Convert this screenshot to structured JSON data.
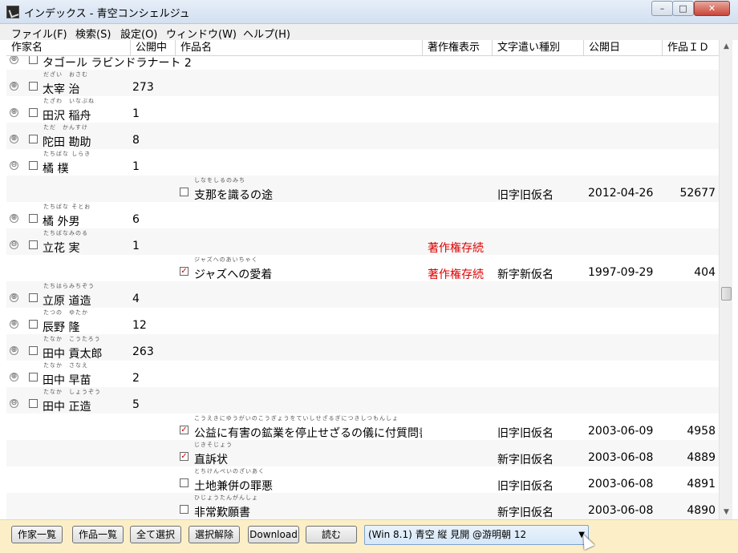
{
  "window": {
    "title": "インデックス - 青空コンシェルジュ",
    "min": "–",
    "max": "□",
    "close": "✕"
  },
  "menu": [
    "ファイル(F)",
    "検索(S)",
    "設定(O)",
    "ウィンドウ(W)",
    "ヘルプ(H)"
  ],
  "columns": [
    "作家名",
    "公開中",
    "作品名",
    "著作権表示",
    "文字遣い種別",
    "公開日",
    "作品ＩＤ"
  ],
  "rows": [
    {
      "type": "author",
      "expander": "⊕",
      "ruby": "",
      "name": "タゴール ラビンドラナート 2",
      "count": ""
    },
    {
      "type": "author",
      "expander": "⊕",
      "ruby": "だざい　おさむ",
      "name": "太宰 治",
      "count": "273"
    },
    {
      "type": "author",
      "expander": "⊕",
      "ruby": "たざわ　いなぶね",
      "name": "田沢 稲舟",
      "count": "1"
    },
    {
      "type": "author",
      "expander": "⊕",
      "ruby": "ただ　かんすけ",
      "name": "陀田 勘助",
      "count": "8"
    },
    {
      "type": "author",
      "expander": "⊖",
      "ruby": "たちばな しらき",
      "name": "橘 樸",
      "count": "1"
    },
    {
      "type": "work",
      "checked": false,
      "ruby": "しなをしるのみち",
      "title": "支那を識るの途",
      "copyright": "",
      "kana": "旧字旧仮名",
      "date": "2012-04-26",
      "id": "52677"
    },
    {
      "type": "author",
      "expander": "⊕",
      "ruby": "たちばな そとお",
      "name": "橘 外男",
      "count": "6"
    },
    {
      "type": "author",
      "expander": "⊖",
      "ruby": "たちばなみのる",
      "name": "立花 実",
      "count": "1",
      "copyright": "著作権存続"
    },
    {
      "type": "work",
      "checked": true,
      "ruby": "ジャズへのあいちゃく",
      "title": "ジャズへの愛着",
      "copyright": "著作権存続",
      "kana": "新字新仮名",
      "date": "1997-09-29",
      "id": "404"
    },
    {
      "type": "author",
      "expander": "⊕",
      "ruby": "たちはらみちぞう",
      "name": "立原 道造",
      "count": "4"
    },
    {
      "type": "author",
      "expander": "⊕",
      "ruby": "たつの　ゆたか",
      "name": "辰野 隆",
      "count": "12"
    },
    {
      "type": "author",
      "expander": "⊕",
      "ruby": "たなか　こうたろう",
      "name": "田中 貢太郎",
      "count": "263"
    },
    {
      "type": "author",
      "expander": "⊕",
      "ruby": "たなか　さなえ",
      "name": "田中 早苗",
      "count": "2"
    },
    {
      "type": "author",
      "expander": "⊖",
      "ruby": "たなか　しょうぞう",
      "name": "田中 正造",
      "count": "5"
    },
    {
      "type": "work",
      "checked": true,
      "ruby": "こうえきにゆうがいのこうぎょうをていしせざるぎにつきしつもんしょ",
      "title": "公益に有害の鉱業を停止せざるの儀に付質問書",
      "copyright": "",
      "kana": "旧字旧仮名",
      "date": "2003-06-09",
      "id": "4958"
    },
    {
      "type": "work",
      "checked": true,
      "ruby": "じきそじょう",
      "title": "直訴状",
      "copyright": "",
      "kana": "新字旧仮名",
      "date": "2003-06-08",
      "id": "4889"
    },
    {
      "type": "work",
      "checked": false,
      "ruby": "とちけんぺいのざいあく",
      "title": "土地兼併の罪悪",
      "copyright": "",
      "kana": "旧字旧仮名",
      "date": "2003-06-08",
      "id": "4891"
    },
    {
      "type": "work",
      "checked": false,
      "ruby": "ひじょうたんがんしょ",
      "title": "非常歎願書",
      "copyright": "",
      "kana": "新字旧仮名",
      "date": "2003-06-08",
      "id": "4890"
    }
  ],
  "buttons": [
    "作家一覧",
    "作品一覧",
    "全て選択",
    "選択解除",
    "Download",
    "読む"
  ],
  "viewer_select": "(Win 8.1) 青空 縦 見開 @游明朝 12",
  "colors": {
    "accent_red": "#d00000",
    "bottombar": "#fcefc7",
    "select_blue": "#d5e7f9"
  }
}
